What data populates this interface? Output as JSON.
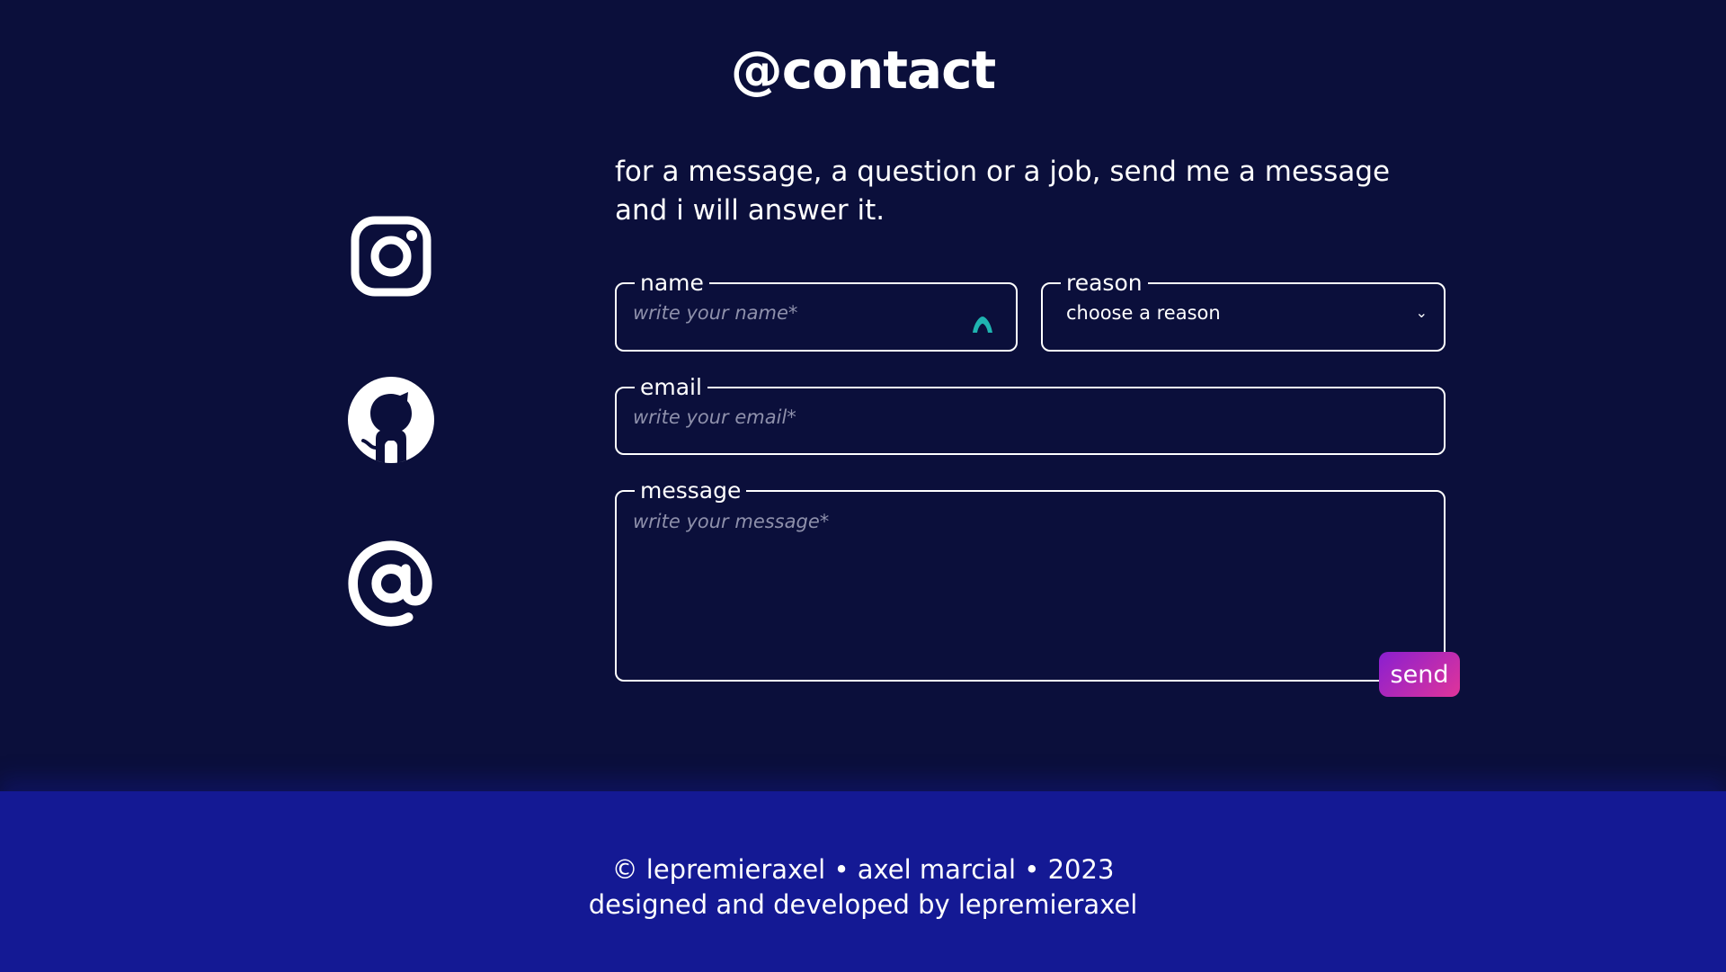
{
  "page": {
    "title": "@contact"
  },
  "intro": {
    "text": "for a message, a question or a job, send me a message and i will answer it."
  },
  "socials": [
    {
      "icon": "instagram-icon",
      "label": "instagram"
    },
    {
      "icon": "github-icon",
      "label": "github"
    },
    {
      "icon": "at-sign-icon",
      "label": "email"
    }
  ],
  "form": {
    "name": {
      "label": "name",
      "placeholder": "write your name*",
      "value": ""
    },
    "reason": {
      "label": "reason",
      "selected": "choose a reason"
    },
    "email": {
      "label": "email",
      "placeholder": "write your email*",
      "value": ""
    },
    "message": {
      "label": "message",
      "placeholder": "write your message*",
      "value": ""
    },
    "send_label": "send"
  },
  "footer": {
    "line1": "© lepremieraxel • axel marcial • 2023",
    "line2": "designed and developed by lepremieraxel"
  },
  "colors": {
    "background": "#0b0f3b",
    "footer_bg": "#141994",
    "send_gradient_start": "#8a1fd0",
    "send_gradient_end": "#e0349a",
    "text": "#ffffff",
    "placeholder": "#8e90ab"
  }
}
